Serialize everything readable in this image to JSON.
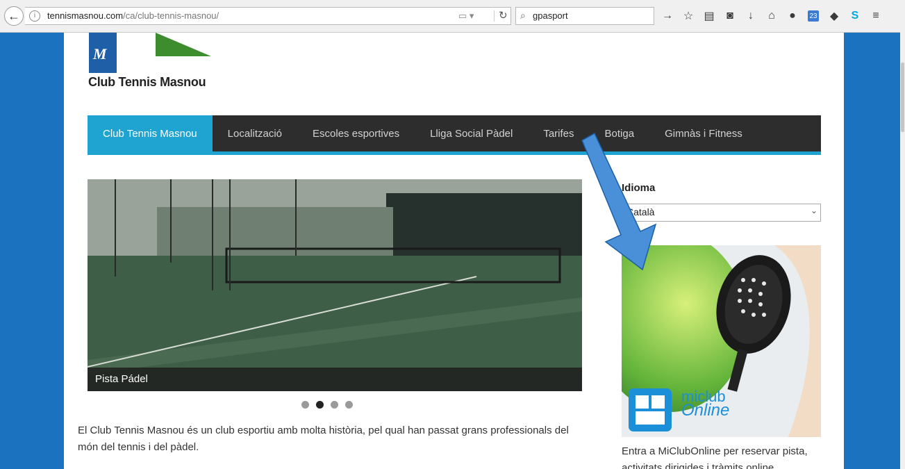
{
  "browser": {
    "url_domain": "tennismasnou.com",
    "url_path": "/ca/club-tennis-masnou/",
    "search_value": "gpasport"
  },
  "site": {
    "logo_letter": "M",
    "club_name": "Club Tennis Masnou"
  },
  "nav": {
    "items": [
      "Club Tennis Masnou",
      "Localització",
      "Escoles esportives",
      "Lliga Social Pàdel",
      "Tarifes",
      "Botiga",
      "Gimnàs i Fitness"
    ],
    "active_index": 0
  },
  "slider": {
    "caption": "Pista Pádel",
    "slide_count": 4,
    "active_slide": 2
  },
  "main": {
    "intro_text": "El Club Tennis Masnou és un club esportiu amb molta història, pel qual han passat grans professionals del món del tennis i del pàdel."
  },
  "sidebar": {
    "language_title": "Idioma",
    "language_selected": "Català",
    "promo_brand": "miclub",
    "promo_brand_2": "Online",
    "promo_text": "Entra a MiClubOnline per reservar pista, activitats dirigides i tràmits online."
  },
  "colors": {
    "accent": "#1fa4d2",
    "nav_bg": "#2d2d2d",
    "page_bg": "#1b73bf"
  }
}
